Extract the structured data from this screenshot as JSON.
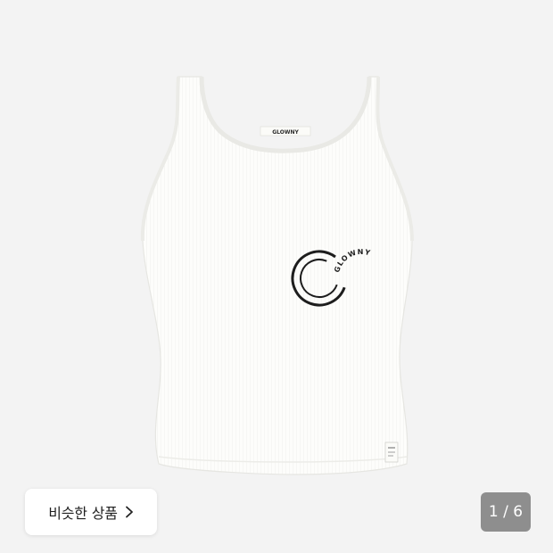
{
  "product": {
    "tag_brand": "GLOWNY",
    "graphic_text": "GLOWNY"
  },
  "similar": {
    "label": "비슷한 상품",
    "icon": "chevron-right-icon"
  },
  "counter": {
    "text": "1 / 6"
  },
  "colors": {
    "background": "#f3f3f3",
    "garment": "#fdfdfb",
    "counter_bg": "#7a7a7a"
  }
}
